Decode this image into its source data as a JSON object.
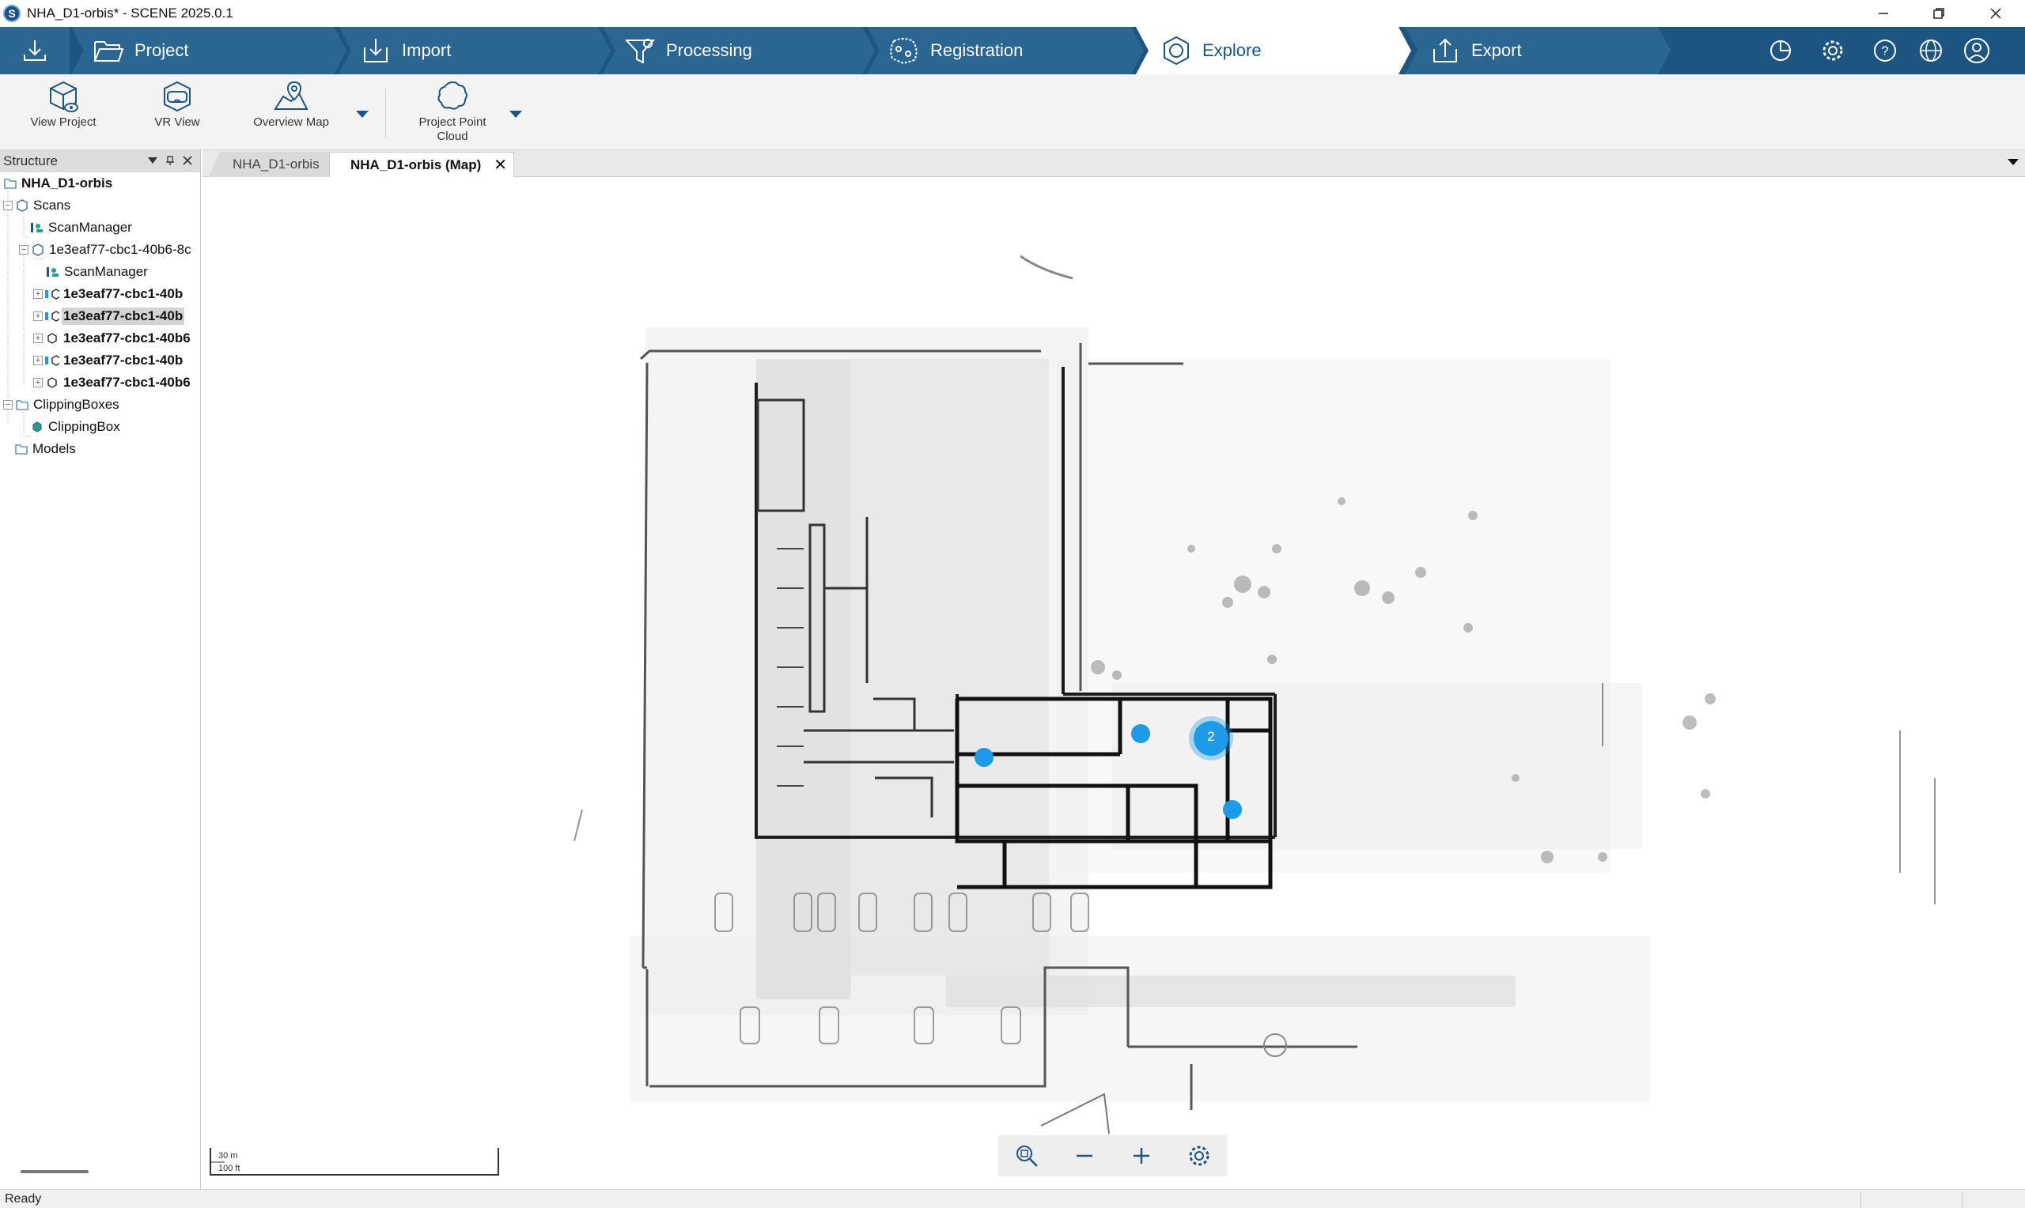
{
  "window": {
    "title": "NHA_D1-orbis* - SCENE 2025.0.1",
    "logo_letter": "S"
  },
  "workflow": {
    "tabs": [
      {
        "label": "Project",
        "icon": "folder-open-icon"
      },
      {
        "label": "Import",
        "icon": "import-icon"
      },
      {
        "label": "Processing",
        "icon": "processing-icon"
      },
      {
        "label": "Registration",
        "icon": "registration-icon"
      },
      {
        "label": "Explore",
        "icon": "explore-icon",
        "active": true
      },
      {
        "label": "Export",
        "icon": "export-icon"
      }
    ],
    "right_icons": [
      "pie-chart-icon",
      "gear-icon",
      "help-icon",
      "sphere-icon",
      "user-icon"
    ]
  },
  "ribbon": {
    "view_project": "View Project",
    "vr_view": "VR View",
    "overview_map": "Overview Map",
    "project_point_cloud_line1": "Project Point",
    "project_point_cloud_line2": "Cloud"
  },
  "structure": {
    "title": "Structure",
    "items": [
      {
        "label": "NHA_D1-orbis",
        "bold": true
      },
      {
        "label": "Scans"
      },
      {
        "label": "ScanManager"
      },
      {
        "label": "1e3eaf77-cbc1-40b6-8c"
      },
      {
        "label": "ScanManager"
      },
      {
        "label": "1e3eaf77-cbc1-40b",
        "bold": true
      },
      {
        "label": "1e3eaf77-cbc1-40b",
        "bold": true,
        "selected": true
      },
      {
        "label": "1e3eaf77-cbc1-40b6",
        "bold": true
      },
      {
        "label": "1e3eaf77-cbc1-40b",
        "bold": true
      },
      {
        "label": "1e3eaf77-cbc1-40b6",
        "bold": true
      },
      {
        "label": "ClippingBoxes"
      },
      {
        "label": "ClippingBox"
      },
      {
        "label": "Models"
      }
    ]
  },
  "doc_tabs": {
    "tab1": "NHA_D1-orbis",
    "tab2": "NHA_D1-orbis (Map)"
  },
  "map": {
    "cluster_count": "2",
    "scale_metric": "30 m",
    "scale_imperial": "100 ft",
    "marker_color": "#1e9be6",
    "toolbar_icons": [
      "zoom-fit-icon",
      "zoom-out-icon",
      "zoom-in-icon",
      "map-settings-icon"
    ]
  },
  "status": {
    "text": "Ready"
  }
}
